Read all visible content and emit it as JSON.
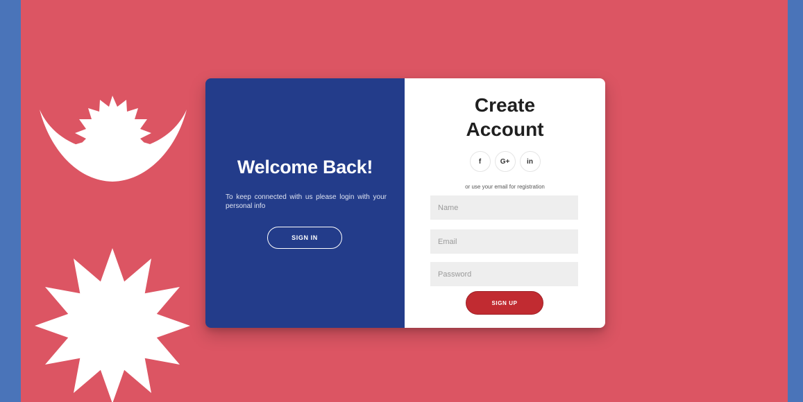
{
  "colors": {
    "background": "#dc5563",
    "border": "#4a74b9",
    "left_panel": "#233c8a",
    "right_panel": "#ffffff",
    "signup_button": "#c12b31",
    "input_background": "#eeeeee"
  },
  "decorations": {
    "moon_icon": "moon-emblem-icon",
    "sun_icon": "sun-emblem-icon"
  },
  "welcome": {
    "title": "Welcome Back!",
    "message": "To keep connected with us please login with your personal info",
    "signin_label": "SIGN IN"
  },
  "signup": {
    "title": "Create\nAccount",
    "socials": [
      {
        "label": "f",
        "icon": "facebook-icon"
      },
      {
        "label": "G+",
        "icon": "google-plus-icon"
      },
      {
        "label": "in",
        "icon": "linkedin-icon"
      }
    ],
    "hint": "or use your email for registration",
    "name_placeholder": "Name",
    "email_placeholder": "Email",
    "password_placeholder": "Password",
    "signup_label": "SIGN UP"
  }
}
